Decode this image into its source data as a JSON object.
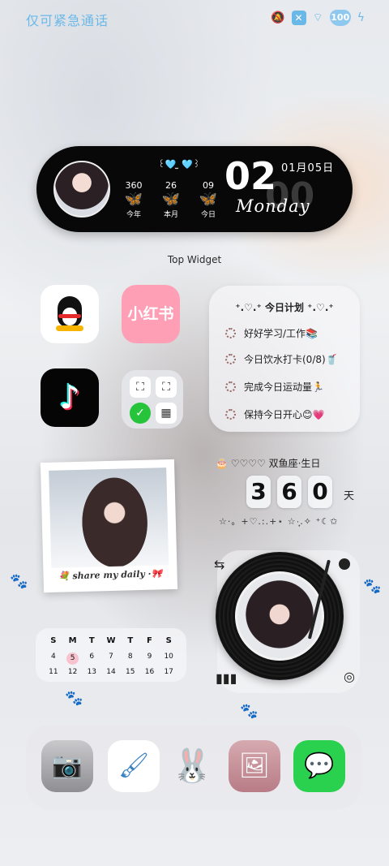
{
  "status_bar": {
    "carrier_text": "仅可紧急通话",
    "mute_icon": "mute-icon",
    "sim_icon": "sim-x-icon",
    "wifi_icon": "wifi-icon",
    "battery": "100",
    "charging_icon": "charging-icon"
  },
  "top_widget": {
    "kaomoji": "꒰🩵 ̫ 🩵꒱",
    "stats": [
      {
        "value": "360",
        "label": "今年"
      },
      {
        "value": "26",
        "label": "本月"
      },
      {
        "value": "09",
        "label": "今日"
      }
    ],
    "hour": "02",
    "minute": "00",
    "date": "01月05日",
    "weekday": "Monday",
    "caption": "Top Widget"
  },
  "apps": {
    "qq": "QQ",
    "xiaohongshu": "小红书",
    "tiktok": "♪"
  },
  "plan_widget": {
    "title": "⁺.♡.⁺ 今日计划 ⁺.♡.⁺",
    "items": [
      "好好学习/工作📚",
      "今日饮水打卡(0/8)🥤",
      "完成今日运动量🏃",
      "保持今日开心😊💗"
    ]
  },
  "countdown": {
    "title": "🎂 ♡♡♡♡ 双鱼座·生日",
    "digits": [
      "3",
      "6",
      "0"
    ],
    "unit": "天",
    "decoration": "☆·。+♡.:.+⋆ ☆·̩͙.✧ ⁺☾✩"
  },
  "polaroid": {
    "caption": "💐 share my daily ·🎀"
  },
  "calendar": {
    "weekdays": [
      "S",
      "M",
      "T",
      "W",
      "T",
      "F",
      "S"
    ],
    "row1": [
      "4",
      "5",
      "6",
      "7",
      "8",
      "9",
      "10"
    ],
    "row2": [
      "11",
      "12",
      "13",
      "14",
      "15",
      "16",
      "17"
    ],
    "today": "5"
  },
  "dock": {
    "camera": "📷",
    "brush": "🖌",
    "bunny": "🐰",
    "gallery": "🖼",
    "wechat": "💬"
  }
}
